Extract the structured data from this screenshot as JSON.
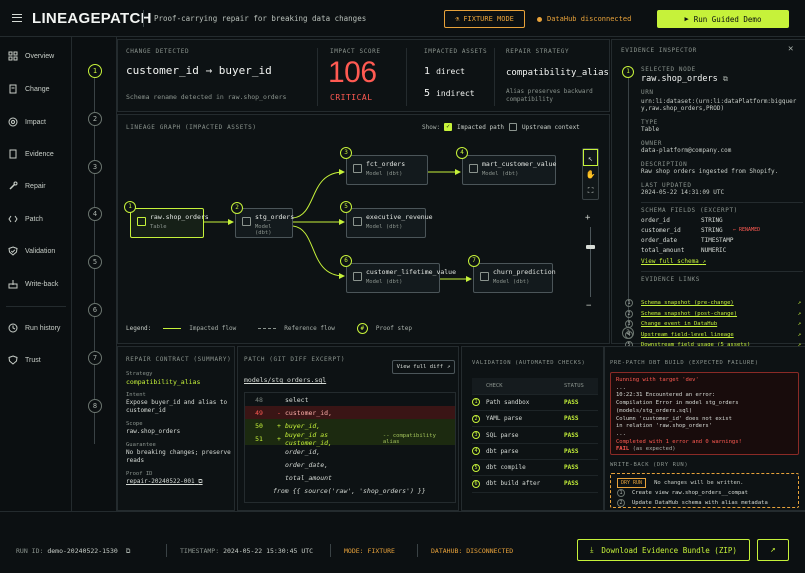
{
  "header": {
    "brand": "LINEAGEPATCH",
    "tagline": "Proof-carrying repair for breaking data changes",
    "fixture_mode": "FIXTURE MODE",
    "datahub_status": "DataHub disconnected",
    "run_demo": "Run Guided Demo"
  },
  "nav": [
    "Overview",
    "Change",
    "Impact",
    "Evidence",
    "Repair",
    "Patch",
    "Validation",
    "Write-back",
    "Run history",
    "Trust"
  ],
  "steps": [
    "1",
    "2",
    "3",
    "4",
    "5",
    "6",
    "7",
    "8"
  ],
  "change": {
    "label": "CHANGE DETECTED",
    "from": "customer_id",
    "arrow": "→",
    "to": "buyer_id",
    "desc": "Schema rename detected in raw.shop_orders"
  },
  "impact": {
    "label": "IMPACT SCORE",
    "score": "106",
    "level": "CRITICAL"
  },
  "assets": {
    "label": "IMPACTED ASSETS",
    "direct_n": "1",
    "direct": "direct",
    "indirect_n": "5",
    "indirect": "indirect"
  },
  "strategy": {
    "label": "REPAIR STRATEGY",
    "name": "compatibility_alias",
    "desc": "Alias preserves backward compatibility"
  },
  "graph": {
    "label": "LINEAGE GRAPH (IMPACTED ASSETS)",
    "show": "Show:",
    "impacted_path": "Impacted path",
    "upstream": "Upstream context",
    "nodes": [
      {
        "n": "1",
        "name": "raw.shop_orders",
        "type": "Table"
      },
      {
        "n": "2",
        "name": "stg_orders",
        "type": "Model (dbt)"
      },
      {
        "n": "3",
        "name": "fct_orders",
        "type": "Model (dbt)"
      },
      {
        "n": "4",
        "name": "mart_customer_value",
        "type": "Model (dbt)"
      },
      {
        "n": "5",
        "name": "executive_revenue",
        "type": "Model (dbt)"
      },
      {
        "n": "6",
        "name": "customer_lifetime_value",
        "type": "Model (dbt)"
      },
      {
        "n": "7",
        "name": "churn_prediction",
        "type": "Model (dbt)"
      }
    ],
    "legend": "Legend:",
    "impacted_flow": "Impacted flow",
    "reference_flow": "Reference flow",
    "proof_step": "Proof step",
    "proof_num": "#"
  },
  "inspector": {
    "label": "EVIDENCE INSPECTOR",
    "selected_label": "SELECTED NODE",
    "selected": "raw.shop_orders",
    "urn_label": "URN",
    "urn": "urn:li:dataset:(urn:li:dataPlatform:bigquery,raw.shop_orders,PROD)",
    "type_label": "TYPE",
    "type": "Table",
    "owner_label": "OWNER",
    "owner": "data-platform@company.com",
    "desc_label": "DESCRIPTION",
    "desc": "Raw shop orders ingested from Shopify.",
    "updated_label": "LAST UPDATED",
    "updated": "2024-05-22 14:31:09 UTC",
    "schema_label": "SCHEMA FIELDS (EXCERPT)",
    "fields": [
      {
        "name": "order_id",
        "type": "STRING",
        "note": ""
      },
      {
        "name": "customer_id",
        "type": "STRING",
        "note": "← RENAMED"
      },
      {
        "name": "order_date",
        "type": "TIMESTAMP",
        "note": ""
      },
      {
        "name": "total_amount",
        "type": "NUMERIC",
        "note": ""
      }
    ],
    "view_schema": "View full schema",
    "links_label": "EVIDENCE LINKS",
    "links": [
      {
        "n": "1",
        "t": "Schema snapshot (pre-change)"
      },
      {
        "n": "2",
        "t": "Schema snapshot (post-change)"
      },
      {
        "n": "3",
        "t": "Change event in DataHub"
      },
      {
        "n": "4",
        "t": "Upstream field-level lineage"
      },
      {
        "n": "5",
        "t": "Downstream field usage (5 assets)"
      }
    ]
  },
  "contract": {
    "label": "REPAIR CONTRACT (SUMMARY)",
    "strategy_l": "Strategy",
    "strategy": "compatibility_alias",
    "intent_l": "Intent",
    "intent": "Expose buyer_id and alias to customer_id",
    "scope_l": "Scope",
    "scope": "raw.shop_orders",
    "guarantee_l": "Guarantee",
    "guarantee": "No breaking changes; preserve reads",
    "proof_l": "Proof ID",
    "proof": "repair-20240522-001"
  },
  "patch": {
    "label": "PATCH (GIT DIFF EXCERPT)",
    "view": "View full diff",
    "file": "models/stg_orders.sql",
    "lines": [
      {
        "ln": "48",
        "g": "",
        "t": "select",
        "c": "",
        "k": "ctx"
      },
      {
        "ln": "49",
        "g": "-",
        "t": "customer_id,",
        "c": "",
        "k": "del"
      },
      {
        "ln": "50",
        "g": "+",
        "t": "buyer_id,",
        "c": "",
        "k": "add"
      },
      {
        "ln": "51",
        "g": "+",
        "t": "buyer_id as customer_id,",
        "c": "-- compatibility alias",
        "k": "add"
      },
      {
        "ln": "",
        "g": "",
        "t": "order_id,",
        "c": "",
        "k": "ctx"
      },
      {
        "ln": "",
        "g": "",
        "t": "order_date,",
        "c": "",
        "k": "ctx"
      },
      {
        "ln": "",
        "g": "",
        "t": "total_amount",
        "c": "",
        "k": "ctx"
      },
      {
        "ln": "",
        "g": "",
        "t": "from {{ source('raw', 'shop_orders') }}",
        "c": "",
        "k": "ctx"
      }
    ]
  },
  "validation": {
    "label": "VALIDATION (AUTOMATED CHECKS)",
    "col_check": "CHECK",
    "col_status": "STATUS",
    "checks": [
      {
        "n": "1",
        "name": "Path sandbox",
        "status": "PASS"
      },
      {
        "n": "2",
        "name": "YAML parse",
        "status": "PASS"
      },
      {
        "n": "3",
        "name": "SQL parse",
        "status": "PASS"
      },
      {
        "n": "4",
        "name": "dbt parse",
        "status": "PASS"
      },
      {
        "n": "5",
        "name": "dbt compile",
        "status": "PASS"
      },
      {
        "n": "6",
        "name": "dbt build after",
        "status": "PASS"
      }
    ]
  },
  "prebuild": {
    "label": "PRE-PATCH DBT BUILD (EXPECTED FAILURE)",
    "l1": "Running with target 'dev'",
    "l2": "...",
    "l3": "10:22:31  Encountered an error:",
    "l4": "Compilation Error in model stg_orders (models/stg_orders.sql)",
    "l5": "Column 'customer_id' does not exist",
    "l6": "in relation 'raw.shop_orders'",
    "l7": "...",
    "l8": "Completed with 1 error and 0 warnings!",
    "fail": "FAIL",
    "fail_note": "(as expected)"
  },
  "writeback": {
    "label": "WRITE-BACK (DRY RUN)",
    "badge": "DRY RUN",
    "note": "No changes will be written.",
    "items": [
      {
        "n": "1",
        "t": "Create view raw.shop_orders__compat"
      },
      {
        "n": "2",
        "t": "Update DataHub schema with alias metadata"
      }
    ]
  },
  "footer": {
    "run_l": "RUN ID:",
    "run": "demo-20240522-1530",
    "ts_l": "TIMESTAMP:",
    "ts": "2024-05-22 15:30:45 UTC",
    "mode_l": "MODE:",
    "mode": "FIXTURE",
    "dh_l": "DATAHUB:",
    "dh": "DISCONNECTED",
    "download": "Download Evidence Bundle (ZIP)"
  },
  "colors": {
    "accent": "#c6f23a",
    "critical": "#ff5a52",
    "warn": "#e8a23a",
    "bg": "#0b0f11"
  }
}
